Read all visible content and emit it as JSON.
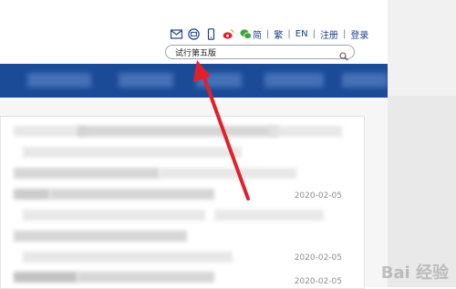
{
  "header": {
    "icons": [
      "mail-icon",
      "chat-icon",
      "mobile-icon",
      "weibo-icon",
      "wechat-icon"
    ],
    "lang_links": [
      "简",
      "繁",
      "EN",
      "注册",
      "登录"
    ]
  },
  "search": {
    "value": "试行第五版",
    "placeholder": ""
  },
  "list": {
    "dates": [
      "2020-02-05",
      "2020-02-05",
      "2020-02-05"
    ]
  },
  "colors": {
    "nav_blue": "#1b4a97",
    "arrow_red": "#e3202a",
    "link_blue": "#1a3f8e"
  },
  "watermark": {
    "text": "Bai 经验"
  }
}
